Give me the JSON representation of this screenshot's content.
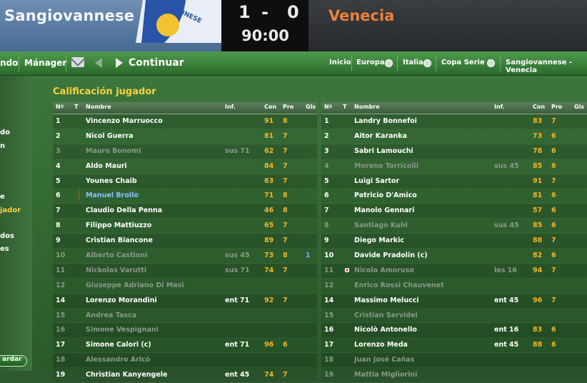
{
  "match": {
    "home_team": "Sangiovannese",
    "away_team": "Venecia",
    "home_score": "1",
    "separator": "-",
    "away_score": "0",
    "clock": "90:00"
  },
  "nav": {
    "cut_left": "ndo",
    "manager": "Mánager",
    "continue": "Continuar",
    "crumbs": [
      "Inicio",
      "Europa",
      "Italia",
      "Copa Serie C",
      "Sangiovannese - Venecia"
    ]
  },
  "sidebar": {
    "items": [
      "do",
      "n",
      "e",
      "jador",
      "dos",
      "es"
    ],
    "button": "ardar"
  },
  "panel_title": "Calificación jugador",
  "columns": {
    "no": "Nº",
    "t": "T",
    "name": "Nombre",
    "inf": "Inf.",
    "con": "Con",
    "pro": "Pro",
    "gls": "Gls"
  },
  "home_players": [
    {
      "no": "1",
      "name": "Vincenzo Marruocco",
      "inf": "",
      "con": "91",
      "pro": "8",
      "gls": ""
    },
    {
      "no": "2",
      "name": "Nicol Guerra",
      "inf": "",
      "con": "81",
      "pro": "7",
      "gls": ""
    },
    {
      "no": "3",
      "name": "Mauro Bonomi",
      "inf": "sus 71",
      "con": "62",
      "pro": "7",
      "gls": "",
      "dim": true
    },
    {
      "no": "4",
      "name": "Aldo Mauri",
      "inf": "",
      "con": "84",
      "pro": "7",
      "gls": ""
    },
    {
      "no": "5",
      "name": "Younes Chaib",
      "inf": "",
      "con": "63",
      "pro": "7",
      "gls": ""
    },
    {
      "no": "6",
      "name": "Manuel Brollo",
      "inf": "",
      "con": "71",
      "pro": "8",
      "gls": "",
      "link": true,
      "bar": true
    },
    {
      "no": "7",
      "name": "Claudio Della Penna",
      "inf": "",
      "con": "46",
      "pro": "8",
      "gls": ""
    },
    {
      "no": "8",
      "name": "Filippo Mattiuzzo",
      "inf": "",
      "con": "65",
      "pro": "7",
      "gls": ""
    },
    {
      "no": "9",
      "name": "Cristian Biancone",
      "inf": "",
      "con": "89",
      "pro": "7",
      "gls": ""
    },
    {
      "no": "10",
      "name": "Alberto Castioni",
      "inf": "sus 45",
      "con": "73",
      "pro": "8",
      "gls": "1",
      "dim": true
    },
    {
      "no": "11",
      "name": "Nickolas Varutti",
      "inf": "sus 71",
      "con": "74",
      "pro": "7",
      "gls": "",
      "dim": true
    },
    {
      "no": "12",
      "name": "Giuseppe Adriano Di Masi",
      "inf": "",
      "con": "",
      "pro": "",
      "gls": "",
      "dim": true
    },
    {
      "no": "14",
      "name": "Lorenzo Morandini",
      "inf": "ent 71",
      "con": "92",
      "pro": "7",
      "gls": ""
    },
    {
      "no": "15",
      "name": "Andrea Tasca",
      "inf": "",
      "con": "",
      "pro": "",
      "gls": "",
      "dim": true
    },
    {
      "no": "16",
      "name": "Simone Vespignani",
      "inf": "",
      "con": "",
      "pro": "",
      "gls": "",
      "dim": true
    },
    {
      "no": "17",
      "name": "Simone Calori (c)",
      "inf": "ent 71",
      "con": "96",
      "pro": "6",
      "gls": ""
    },
    {
      "no": "18",
      "name": "Alessandro Aricò",
      "inf": "",
      "con": "",
      "pro": "",
      "gls": "",
      "dim": true
    },
    {
      "no": "19",
      "name": "Christian Kanyengele",
      "inf": "ent 45",
      "con": "74",
      "pro": "7",
      "gls": ""
    }
  ],
  "away_players": [
    {
      "no": "1",
      "name": "Landry Bonnefoi",
      "inf": "",
      "con": "83",
      "pro": "7",
      "gls": ""
    },
    {
      "no": "2",
      "name": "Aitor Karanka",
      "inf": "",
      "con": "73",
      "pro": "6",
      "gls": ""
    },
    {
      "no": "3",
      "name": "Sabri Lamouchi",
      "inf": "",
      "con": "78",
      "pro": "6",
      "gls": ""
    },
    {
      "no": "4",
      "name": "Moreno Torricelli",
      "inf": "sus 45",
      "con": "85",
      "pro": "6",
      "gls": "",
      "dim": true
    },
    {
      "no": "5",
      "name": "Luigi Sartor",
      "inf": "",
      "con": "91",
      "pro": "7",
      "gls": ""
    },
    {
      "no": "6",
      "name": "Patricio D'Amico",
      "inf": "",
      "con": "81",
      "pro": "6",
      "gls": ""
    },
    {
      "no": "7",
      "name": "Manolo Gennari",
      "inf": "",
      "con": "57",
      "pro": "6",
      "gls": ""
    },
    {
      "no": "8",
      "name": "Santiago Kuhl",
      "inf": "sus 45",
      "con": "85",
      "pro": "6",
      "gls": "",
      "dim": true
    },
    {
      "no": "9",
      "name": "Diego Markic",
      "inf": "",
      "con": "88",
      "pro": "7",
      "gls": ""
    },
    {
      "no": "10",
      "name": "Davide Pradolin (c)",
      "inf": "",
      "con": "82",
      "pro": "6",
      "gls": ""
    },
    {
      "no": "11",
      "name": "Nicola Amoruso",
      "inf": "les 16",
      "con": "94",
      "pro": "7",
      "gls": "",
      "dim": true,
      "injury": true
    },
    {
      "no": "12",
      "name": "Enrico Rossi Chauvenet",
      "inf": "",
      "con": "",
      "pro": "",
      "gls": "",
      "dim": true
    },
    {
      "no": "14",
      "name": "Massimo Melucci",
      "inf": "ent 45",
      "con": "96",
      "pro": "7",
      "gls": ""
    },
    {
      "no": "15",
      "name": "Cristian Servidei",
      "inf": "",
      "con": "",
      "pro": "",
      "gls": "",
      "dim": true
    },
    {
      "no": "16",
      "name": "Nicolò Antonello",
      "inf": "ent 16",
      "con": "83",
      "pro": "6",
      "gls": ""
    },
    {
      "no": "17",
      "name": "Lorenzo Meda",
      "inf": "ent 45",
      "con": "88",
      "pro": "6",
      "gls": ""
    },
    {
      "no": "18",
      "name": "Juan José Cañas",
      "inf": "",
      "con": "",
      "pro": "",
      "gls": "",
      "dim": true
    },
    {
      "no": "19",
      "name": "Mattia Migliorini",
      "inf": "",
      "con": "",
      "pro": "",
      "gls": "",
      "dim": true
    }
  ],
  "colors": {
    "accent_yellow": "#f7d23c",
    "rating_orange": "#f4b524",
    "away_orange": "#e9823a",
    "goal_blue": "#6fb6ff"
  }
}
